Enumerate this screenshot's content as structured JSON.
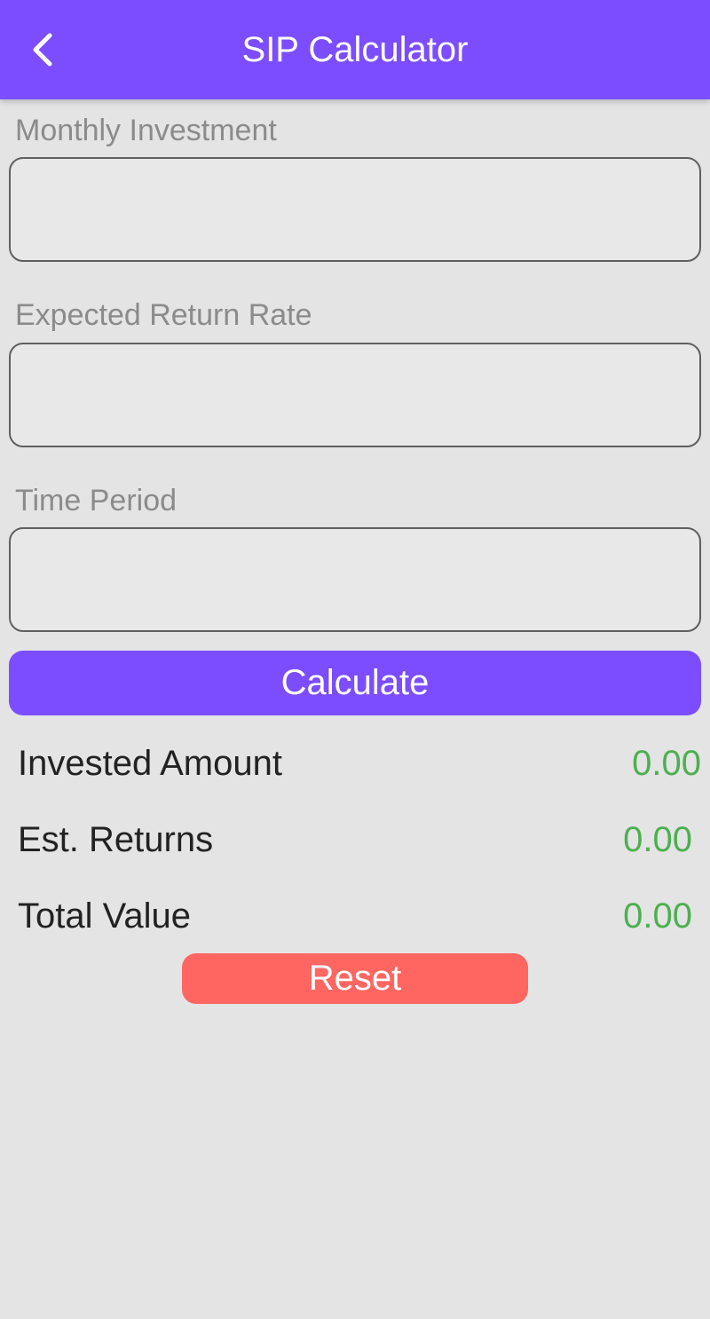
{
  "app_bar": {
    "title": "SIP Calculator",
    "back_icon": "chevron-left-icon",
    "color": "#7c4dff"
  },
  "form": {
    "monthly_investment": {
      "label": "Monthly Investment",
      "value": ""
    },
    "expected_return_rate": {
      "label": "Expected Return Rate",
      "value": ""
    },
    "time_period": {
      "label": "Time Period",
      "value": ""
    }
  },
  "buttons": {
    "calculate": {
      "label": "Calculate",
      "color": "#7c4dff"
    },
    "reset": {
      "label": "Reset",
      "color": "#ff6661"
    }
  },
  "results": {
    "invested_amount": {
      "label": "Invested Amount",
      "value": "0.00"
    },
    "est_returns": {
      "label": "Est. Returns",
      "value": "0.00"
    },
    "total_value": {
      "label": "Total Value",
      "value": "0.00"
    },
    "value_color": "#4caf50"
  }
}
